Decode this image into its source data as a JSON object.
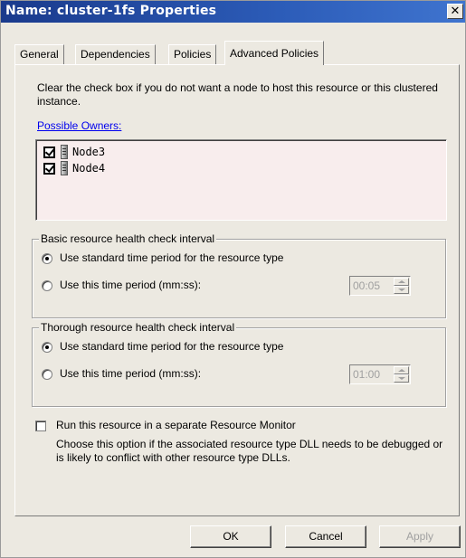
{
  "window": {
    "title": "Name: cluster-1fs Properties",
    "close_glyph": "✕"
  },
  "tabs": [
    {
      "label": "General",
      "active": false
    },
    {
      "label": "Dependencies",
      "active": false
    },
    {
      "label": "Policies",
      "active": false
    },
    {
      "label": "Advanced Policies",
      "active": true
    }
  ],
  "advanced": {
    "intro_text": "Clear the check box if you do not want a node to host this resource or this clustered instance.",
    "possible_owners_link": "Possible Owners:",
    "owners": [
      {
        "name": "Node3",
        "checked": true,
        "icon": "server-icon"
      },
      {
        "name": "Node4",
        "checked": true,
        "icon": "server-icon"
      }
    ],
    "basic_check": {
      "legend": "Basic resource health check interval",
      "option_standard": "Use standard time period for the resource type",
      "option_custom": "Use this time period (mm:ss):",
      "selected": "standard",
      "time_value": "00:05"
    },
    "thorough_check": {
      "legend": "Thorough resource health check interval",
      "option_standard": "Use standard time period for the resource type",
      "option_custom": "Use this time period (mm:ss):",
      "selected": "standard",
      "time_value": "01:00"
    },
    "separate_monitor": {
      "label": "Run this resource in a separate Resource Monitor",
      "checked": false,
      "description": "Choose this option if the associated resource type DLL needs to be debugged or is likely to conflict with other resource type DLLs."
    }
  },
  "buttons": {
    "ok": "OK",
    "cancel": "Cancel",
    "apply": "Apply"
  }
}
